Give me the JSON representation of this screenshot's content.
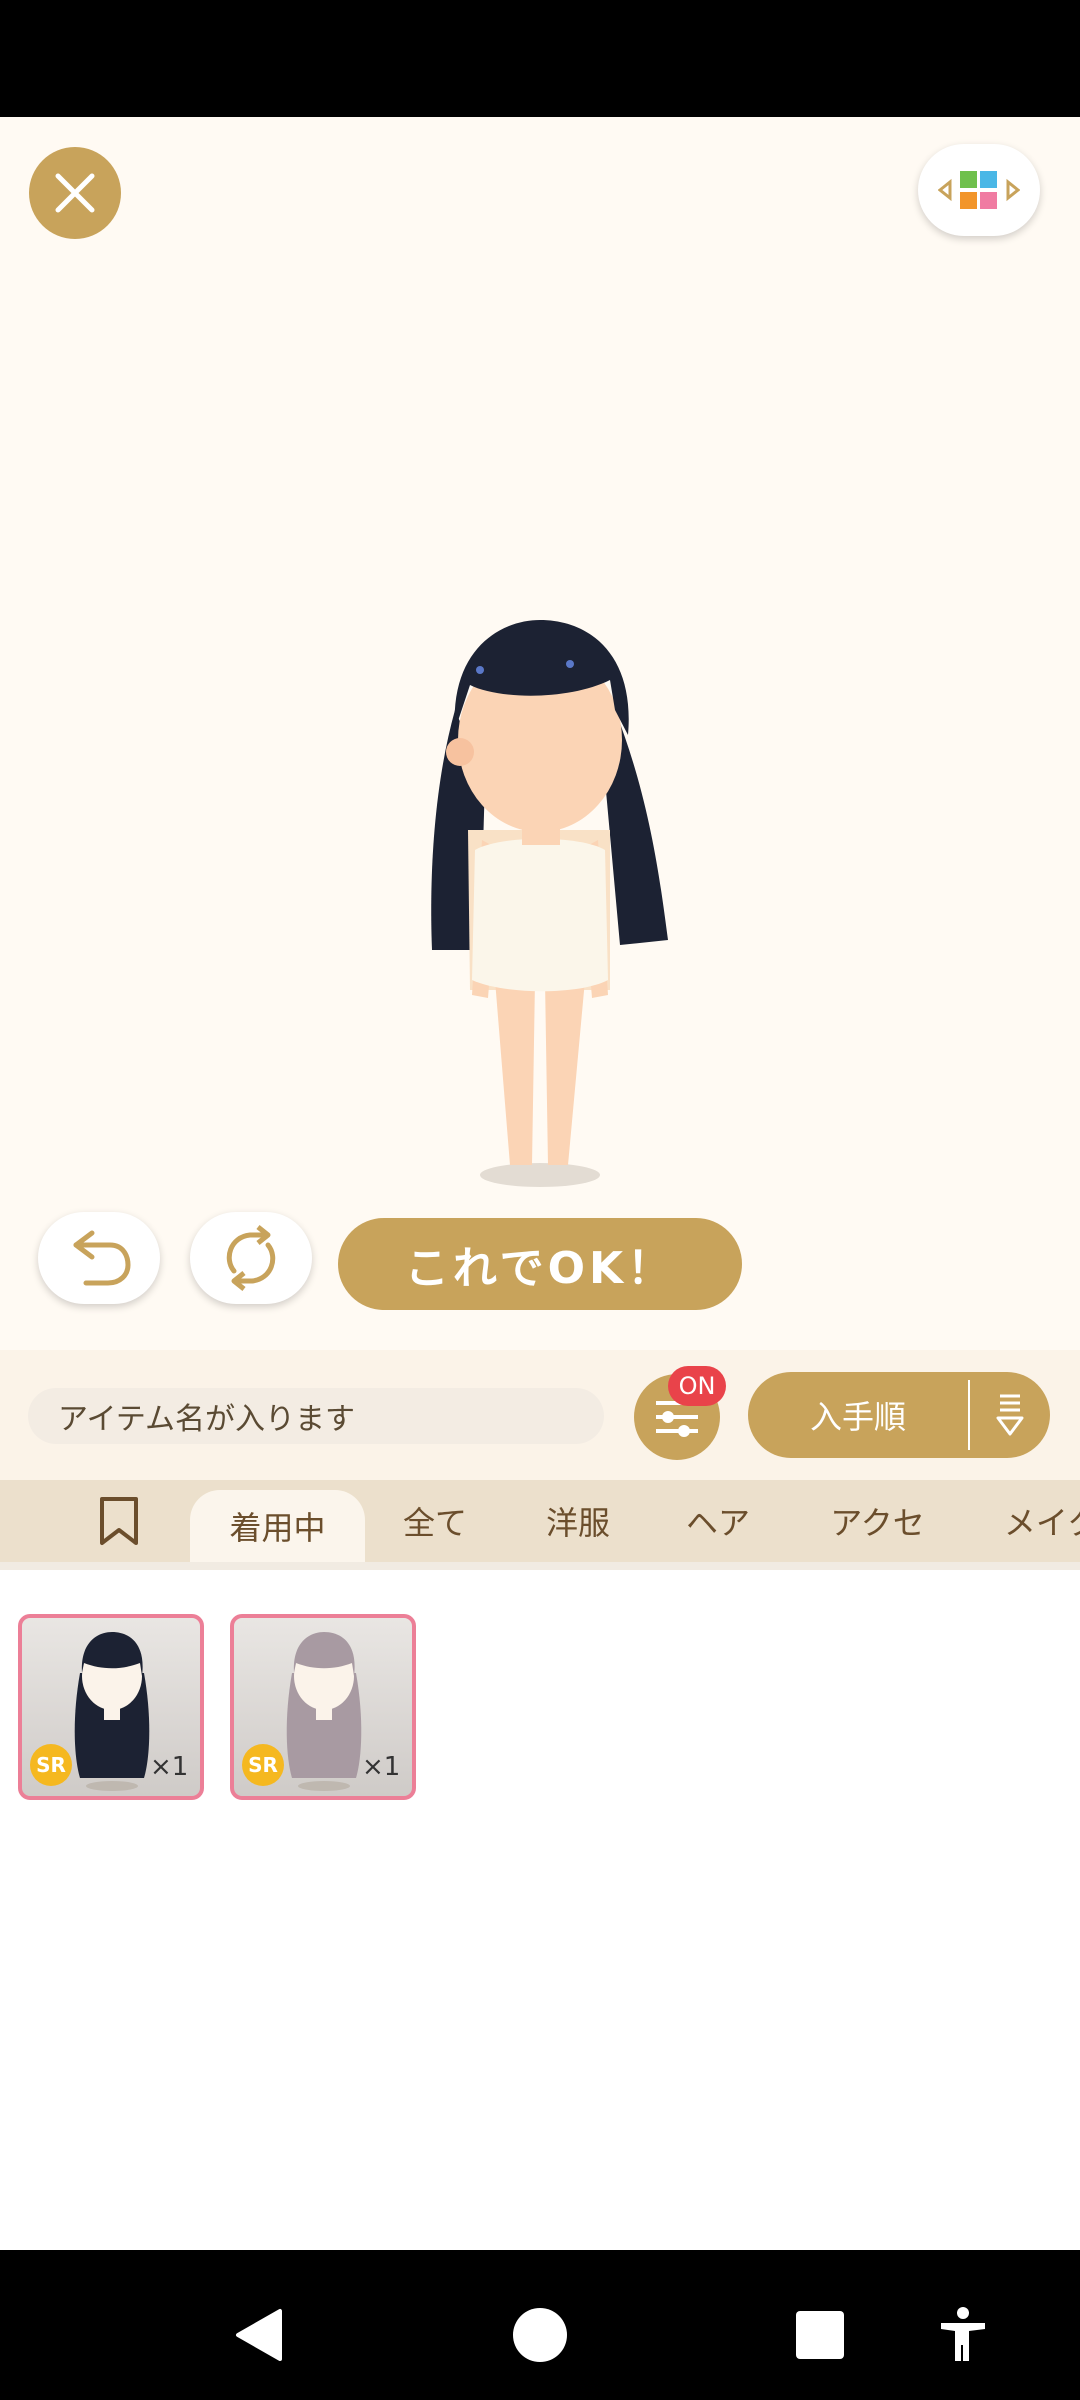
{
  "stage": {
    "ok_button_label": "これでOK！"
  },
  "toolbar": {
    "search_placeholder": "アイテム名が入ります",
    "filter_badge": "ON",
    "sort_label": "入手順"
  },
  "tabs": [
    {
      "label": "着用中",
      "active": true
    },
    {
      "label": "全て",
      "active": false
    },
    {
      "label": "洋服",
      "active": false
    },
    {
      "label": "ヘア",
      "active": false
    },
    {
      "label": "アクセ",
      "active": false
    },
    {
      "label": "メイク",
      "active": false
    }
  ],
  "items": [
    {
      "rarity": "SR",
      "quantity": "×1",
      "hair_color": "#1c2233"
    },
    {
      "rarity": "SR",
      "quantity": "×1",
      "hair_color": "#a89aa2"
    }
  ],
  "colors": {
    "accent": "#c8a35b",
    "badge": "#e9434a",
    "card_border": "#ec7f97"
  }
}
